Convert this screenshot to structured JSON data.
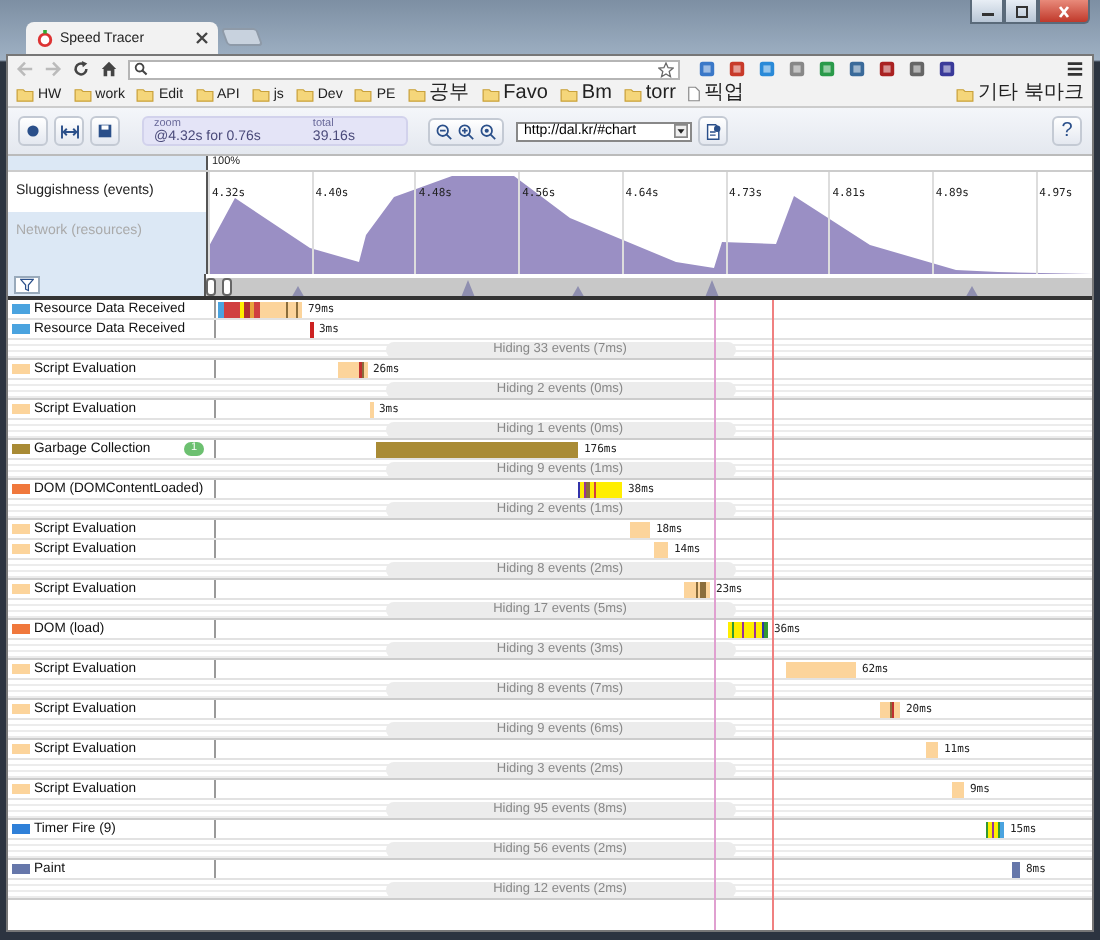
{
  "browser": {
    "tab_title": "Speed Tracer",
    "bookmarks": [
      {
        "label": "HW",
        "kind": "folder"
      },
      {
        "label": "work",
        "kind": "folder"
      },
      {
        "label": "Edit",
        "kind": "folder"
      },
      {
        "label": "API",
        "kind": "folder"
      },
      {
        "label": "js",
        "kind": "folder"
      },
      {
        "label": "Dev",
        "kind": "folder"
      },
      {
        "label": "PE",
        "kind": "folder"
      },
      {
        "label": "공부",
        "kind": "folder"
      },
      {
        "label": "Favo",
        "kind": "folder"
      },
      {
        "label": "Bm",
        "kind": "folder"
      },
      {
        "label": "torr",
        "kind": "folder"
      },
      {
        "label": "픽업",
        "kind": "page"
      }
    ],
    "other_bookmarks": "기타 북마크"
  },
  "toolbar": {
    "zoom_label": "zoom",
    "zoom_value": "@4.32s for 0.76s",
    "total_label": "total",
    "total_value": "39.16s",
    "url": "http://dal.kr/#chart",
    "help": "?"
  },
  "overview": {
    "scale": "100%",
    "ticks": [
      "4.32s",
      "4.40s",
      "4.48s",
      "4.56s",
      "4.64s",
      "4.73s",
      "4.81s",
      "4.89s",
      "4.97s"
    ],
    "tracks": [
      {
        "label": "Sluggishness (events)",
        "selected": true
      },
      {
        "label": "Network (resources)",
        "selected": false
      }
    ]
  },
  "events": [
    {
      "kind": "event",
      "label": "Resource Data Received",
      "color": "#4aa3df",
      "duration": "79ms"
    },
    {
      "kind": "event",
      "label": "Resource Data Received",
      "color": "#4aa3df",
      "duration": "3ms"
    },
    {
      "kind": "hidden",
      "text": "Hiding 33 events (7ms)"
    },
    {
      "kind": "event",
      "label": "Script Evaluation",
      "color": "#fcd49b",
      "duration": "26ms"
    },
    {
      "kind": "hidden",
      "text": "Hiding 2 events (0ms)"
    },
    {
      "kind": "event",
      "label": "Script Evaluation",
      "color": "#fcd49b",
      "duration": "3ms"
    },
    {
      "kind": "hidden",
      "text": "Hiding 1 events (0ms)"
    },
    {
      "kind": "event",
      "label": "Garbage Collection",
      "color": "#a98b35",
      "duration": "176ms",
      "badge": "1"
    },
    {
      "kind": "hidden",
      "text": "Hiding 9 events (1ms)"
    },
    {
      "kind": "event",
      "label": "DOM (DOMContentLoaded)",
      "color": "#f0783c",
      "duration": "38ms"
    },
    {
      "kind": "hidden",
      "text": "Hiding 2 events (1ms)"
    },
    {
      "kind": "event",
      "label": "Script Evaluation",
      "color": "#fcd49b",
      "duration": "18ms"
    },
    {
      "kind": "event",
      "label": "Script Evaluation",
      "color": "#fcd49b",
      "duration": "14ms"
    },
    {
      "kind": "hidden",
      "text": "Hiding 8 events (2ms)"
    },
    {
      "kind": "event",
      "label": "Script Evaluation",
      "color": "#fcd49b",
      "duration": "23ms"
    },
    {
      "kind": "hidden",
      "text": "Hiding 17 events (5ms)"
    },
    {
      "kind": "event",
      "label": "DOM (load)",
      "color": "#f0783c",
      "duration": "36ms"
    },
    {
      "kind": "hidden",
      "text": "Hiding 3 events (3ms)"
    },
    {
      "kind": "event",
      "label": "Script Evaluation",
      "color": "#fcd49b",
      "duration": "62ms"
    },
    {
      "kind": "hidden",
      "text": "Hiding 8 events (7ms)"
    },
    {
      "kind": "event",
      "label": "Script Evaluation",
      "color": "#fcd49b",
      "duration": "20ms"
    },
    {
      "kind": "hidden",
      "text": "Hiding 9 events (6ms)"
    },
    {
      "kind": "event",
      "label": "Script Evaluation",
      "color": "#fcd49b",
      "duration": "11ms"
    },
    {
      "kind": "hidden",
      "text": "Hiding 3 events (2ms)"
    },
    {
      "kind": "event",
      "label": "Script Evaluation",
      "color": "#fcd49b",
      "duration": "9ms"
    },
    {
      "kind": "hidden",
      "text": "Hiding 95 events (8ms)"
    },
    {
      "kind": "event",
      "label": "Timer Fire (9)",
      "color": "#2f80d8",
      "duration": "15ms"
    },
    {
      "kind": "hidden",
      "text": "Hiding 56 events (2ms)"
    },
    {
      "kind": "event",
      "label": "Paint",
      "color": "#6677aa",
      "duration": "8ms"
    },
    {
      "kind": "hidden",
      "text": "Hiding 12 events (2ms)"
    }
  ]
}
